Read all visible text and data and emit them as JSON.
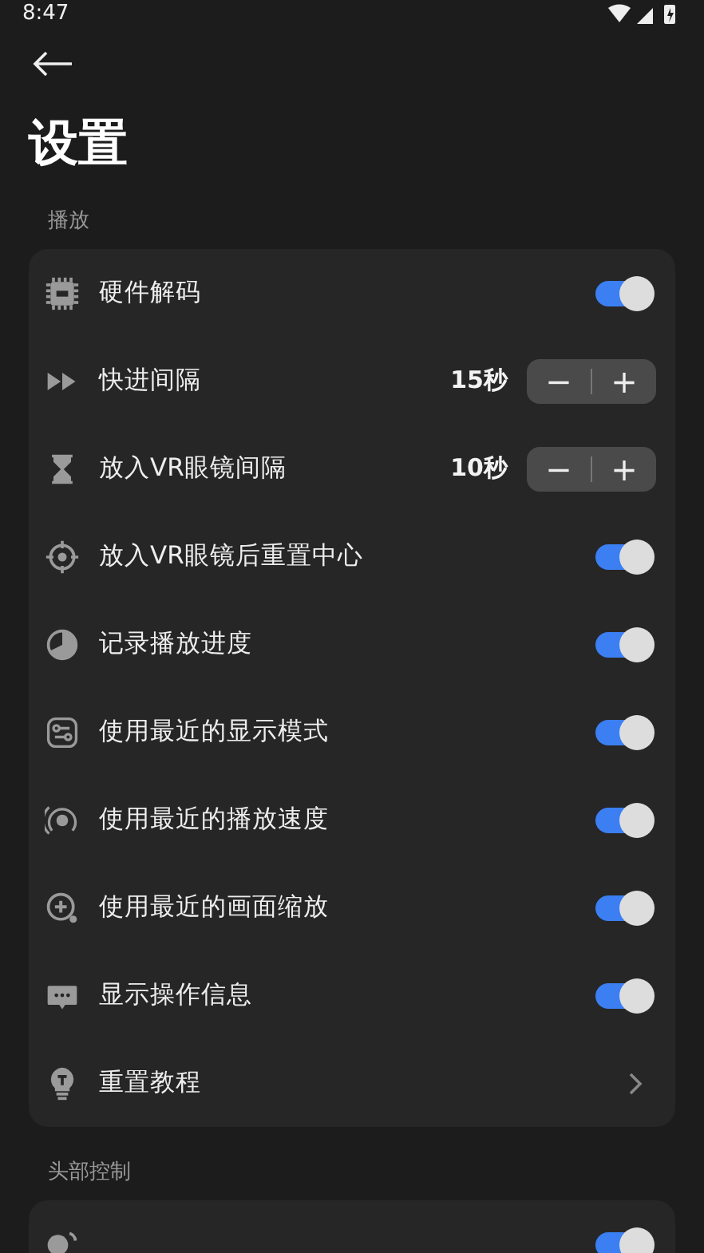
{
  "status_bar": {
    "time": "8:47"
  },
  "title": "设置",
  "sections": [
    {
      "header": "播放",
      "items": [
        {
          "kind": "toggle",
          "label": "硬件解码",
          "on": true
        },
        {
          "kind": "stepper",
          "label": "快进间隔",
          "value": "15秒",
          "minus": "−",
          "plus": "+"
        },
        {
          "kind": "stepper",
          "label": "放入VR眼镜间隔",
          "value": "10秒",
          "minus": "−",
          "plus": "+"
        },
        {
          "kind": "toggle",
          "label": "放入VR眼镜后重置中心",
          "on": true
        },
        {
          "kind": "toggle",
          "label": "记录播放进度",
          "on": true
        },
        {
          "kind": "toggle",
          "label": "使用最近的显示模式",
          "on": true
        },
        {
          "kind": "toggle",
          "label": "使用最近的播放速度",
          "on": true
        },
        {
          "kind": "toggle",
          "label": "使用最近的画面缩放",
          "on": true
        },
        {
          "kind": "toggle",
          "label": "显示操作信息",
          "on": true
        },
        {
          "kind": "link",
          "label": "重置教程"
        }
      ]
    },
    {
      "header": "头部控制",
      "items": [
        {
          "kind": "toggle",
          "on": true
        }
      ]
    }
  ]
}
